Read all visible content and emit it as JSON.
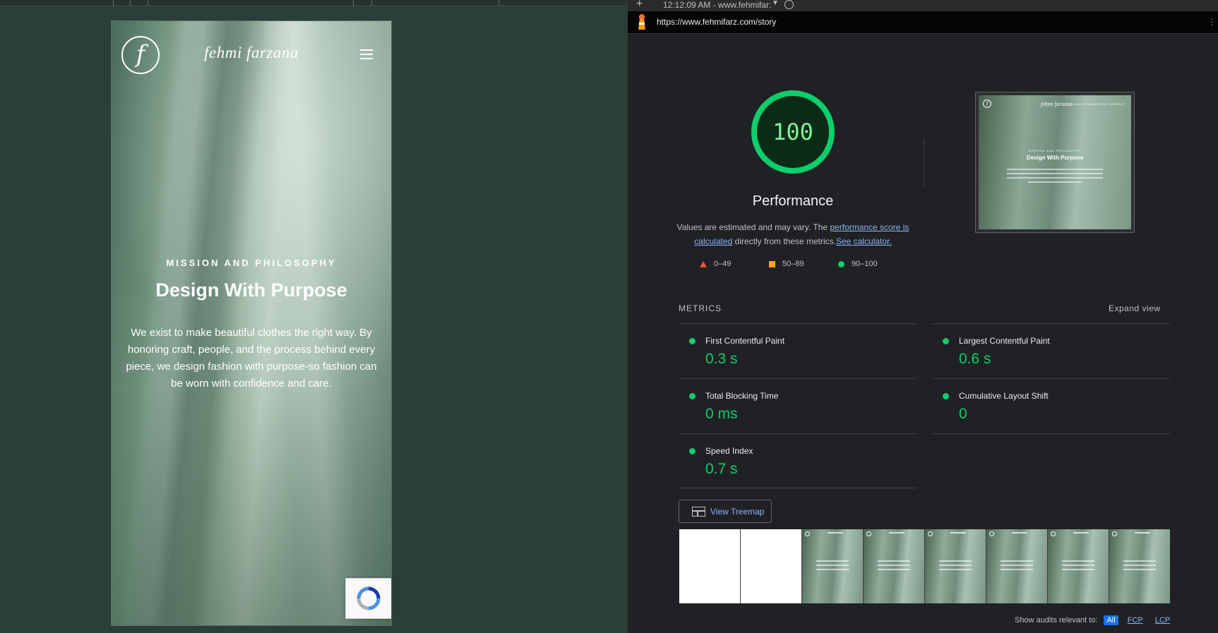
{
  "browser": {
    "tab_title": "12:12:09 AM - www.fehmifar:",
    "url": "https://www.fehmifarz.com/story"
  },
  "site": {
    "logo_letter": "f",
    "brand": "fehmi farzana",
    "eyebrow": "MISSION AND PHILOSOPHY",
    "headline": "Design With Purpose",
    "body": "We exist to make beautiful clothes the right way. By honoring craft, people, and the process behind every piece, we design fashion with purpose-so fashion can be worn with confidence and care."
  },
  "lighthouse": {
    "score": "100",
    "category": "Performance",
    "desc_prefix": "Values are estimated and may vary. The ",
    "desc_link1": "performance score is calculated",
    "desc_middle": " directly from these metrics.",
    "desc_link2": "See calculator.",
    "legend": [
      {
        "label": "0–49",
        "color": "#ff4e42"
      },
      {
        "label": "50–89",
        "color": "#ffa400"
      },
      {
        "label": "90–100",
        "color": "#0cce6b"
      }
    ],
    "metrics_label": "METRICS",
    "expand_label": "Expand view",
    "metrics": [
      {
        "name": "First Contentful Paint",
        "value": "0.3 s"
      },
      {
        "name": "Largest Contentful Paint",
        "value": "0.6 s"
      },
      {
        "name": "Total Blocking Time",
        "value": "0 ms"
      },
      {
        "name": "Cumulative Layout Shift",
        "value": "0"
      },
      {
        "name": "Speed Index",
        "value": "0.7 s"
      }
    ],
    "treemap_label": "View Treemap",
    "audits_label": "Show audits relevant to:",
    "audit_filters": [
      "All",
      "FCP",
      "LCP"
    ],
    "thumb": {
      "brand": "fehmi farzana",
      "nav": "COLLECTIONS STORY CONTACT",
      "eyebrow": "MISSION AND PHILOSOPHY",
      "headline": "Design With Purpose"
    }
  }
}
